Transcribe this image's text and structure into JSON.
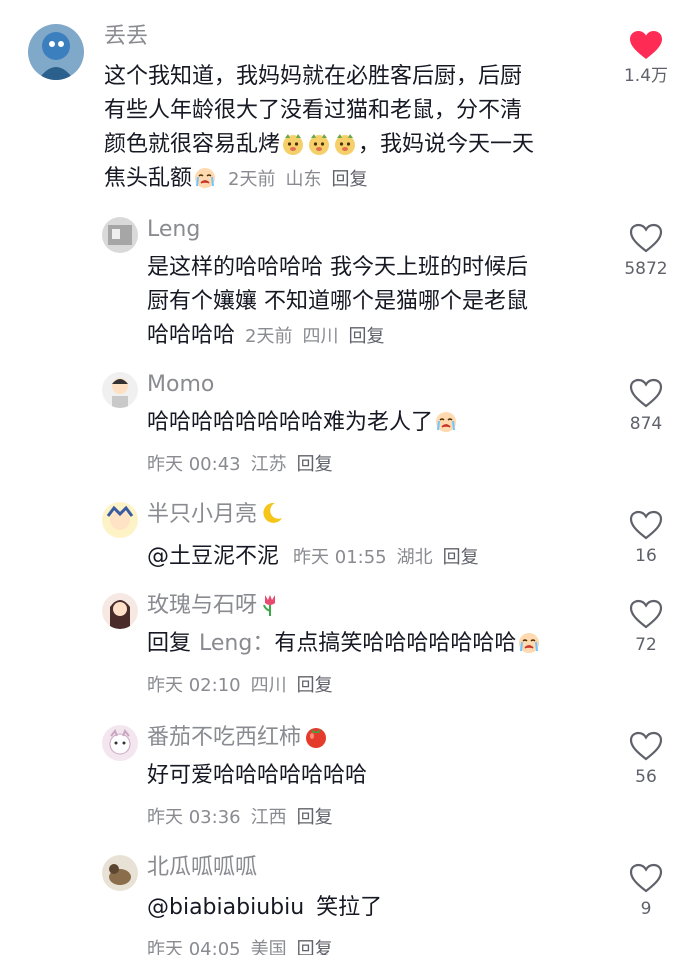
{
  "comments": [
    {
      "username": "丢丢",
      "lines": [
        "这个我知道，我妈妈就在必胜客后厨，后厨",
        "有些人年龄很大了没看过猫和老鼠，分不清",
        "颜色就很容易乱烤",
        "，我妈说今天一天",
        "焦头乱额"
      ],
      "emoji": [
        "dog-face-emoji",
        "crying-face-emoji"
      ],
      "time": "2天前",
      "location": "山东",
      "reply": "回复",
      "likes": "1.4万",
      "liked": true
    },
    {
      "username": "Leng",
      "lines": [
        "是这样的哈哈哈哈 我今天上班的时候后",
        "厨有个孃孃 不知道哪个是猫哪个是老鼠",
        "哈哈哈哈"
      ],
      "time": "2天前",
      "location": "四川",
      "reply": "回复",
      "likes": "5872",
      "liked": false
    },
    {
      "username": "Momo",
      "lines": [
        "哈哈哈哈哈哈哈哈难为老人了"
      ],
      "time": "昨天 00:43",
      "location": "江苏",
      "reply": "回复",
      "likes": "874",
      "liked": false
    },
    {
      "username": "半只小月亮",
      "mention": "@土豆泥不泥",
      "time": "昨天 01:55",
      "location": "湖北",
      "reply": "回复",
      "likes": "16",
      "liked": false
    },
    {
      "username": "玫瑰与石呀",
      "reply_prefix": "回复",
      "reply_to": "Leng",
      "reply_colon": "：",
      "lines": [
        "有点搞笑哈哈哈哈哈哈哈"
      ],
      "time": "昨天 02:10",
      "location": "四川",
      "reply": "回复",
      "likes": "72",
      "liked": false
    },
    {
      "username": "番茄不吃西红柿",
      "lines": [
        "好可爱哈哈哈哈哈哈哈"
      ],
      "time": "昨天 03:36",
      "location": "江西",
      "reply": "回复",
      "likes": "56",
      "liked": false
    },
    {
      "username": "北瓜呱呱呱",
      "mention": "@biabiabiubiu",
      "lines": [
        "笑拉了"
      ],
      "time": "昨天 04:05",
      "location": "美国",
      "reply": "回复",
      "likes": "9",
      "liked": false
    }
  ],
  "colors": {
    "liked": "#fe2c55",
    "text": "#161823",
    "muted": "#8a8b91"
  },
  "icons": {
    "like": "heart-icon",
    "liked": "heart-filled-icon"
  }
}
